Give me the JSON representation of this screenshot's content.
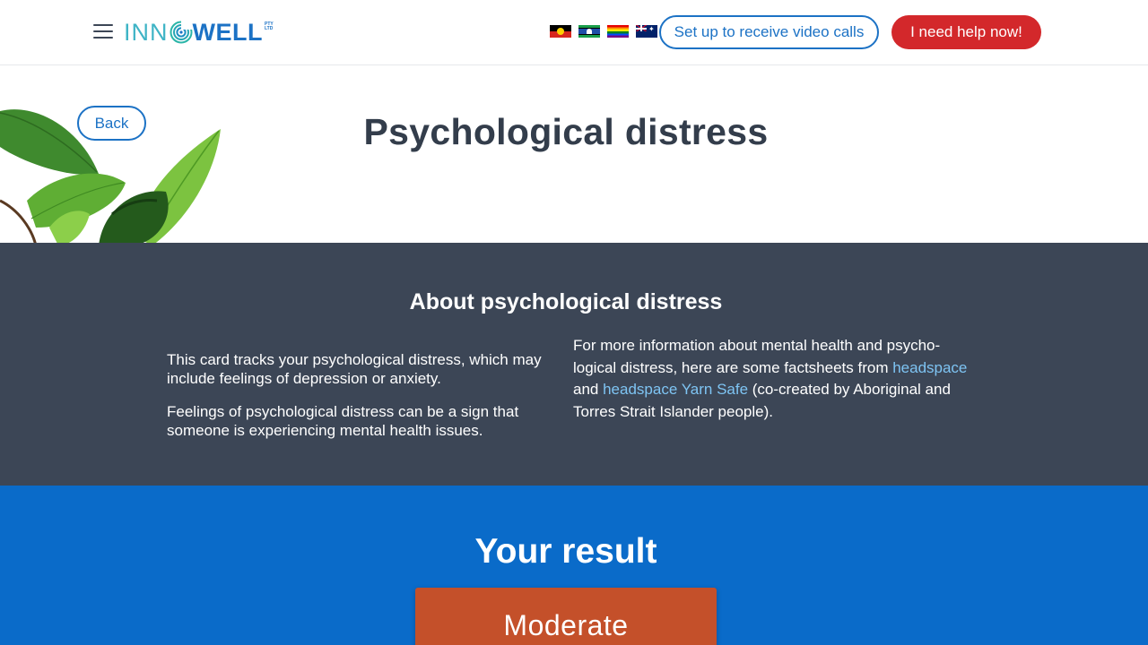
{
  "header": {
    "logo": {
      "inn": "INN",
      "well": "WELL",
      "pty": "PTY LTD"
    },
    "flags": [
      "aboriginal-flag",
      "torres-strait-islander-flag",
      "rainbow-pride-flag",
      "australian-flag"
    ],
    "video_calls_label": "Set up to receive video calls",
    "help_label": "I need help now!"
  },
  "hero": {
    "back_label": "Back",
    "title": "Psychological distress"
  },
  "about": {
    "title": "About psychological distress",
    "left_paragraphs": [
      "This card tracks your psychological distress, which may include feelings of depression or anxiety.",
      "Feelings of psychological distress can be a sign that someone is experiencing mental health issues."
    ],
    "right_text_1": "For more information about mental health and psycho-logical distress, here are some factsheets from ",
    "right_link_1": "headspace",
    "right_text_2": " and ",
    "right_link_2": "headspace Yarn Safe",
    "right_text_3": " (co-created by Aboriginal and Torres Strait Islander people)."
  },
  "result": {
    "title": "Your result",
    "value": "Moderate"
  },
  "colors": {
    "brand_blue": "#1c72c5",
    "help_red": "#d3282b",
    "about_bg": "#3c4656",
    "result_bg": "#0a6bc9",
    "result_card": "#c4502a",
    "link": "#7ec4f3"
  }
}
